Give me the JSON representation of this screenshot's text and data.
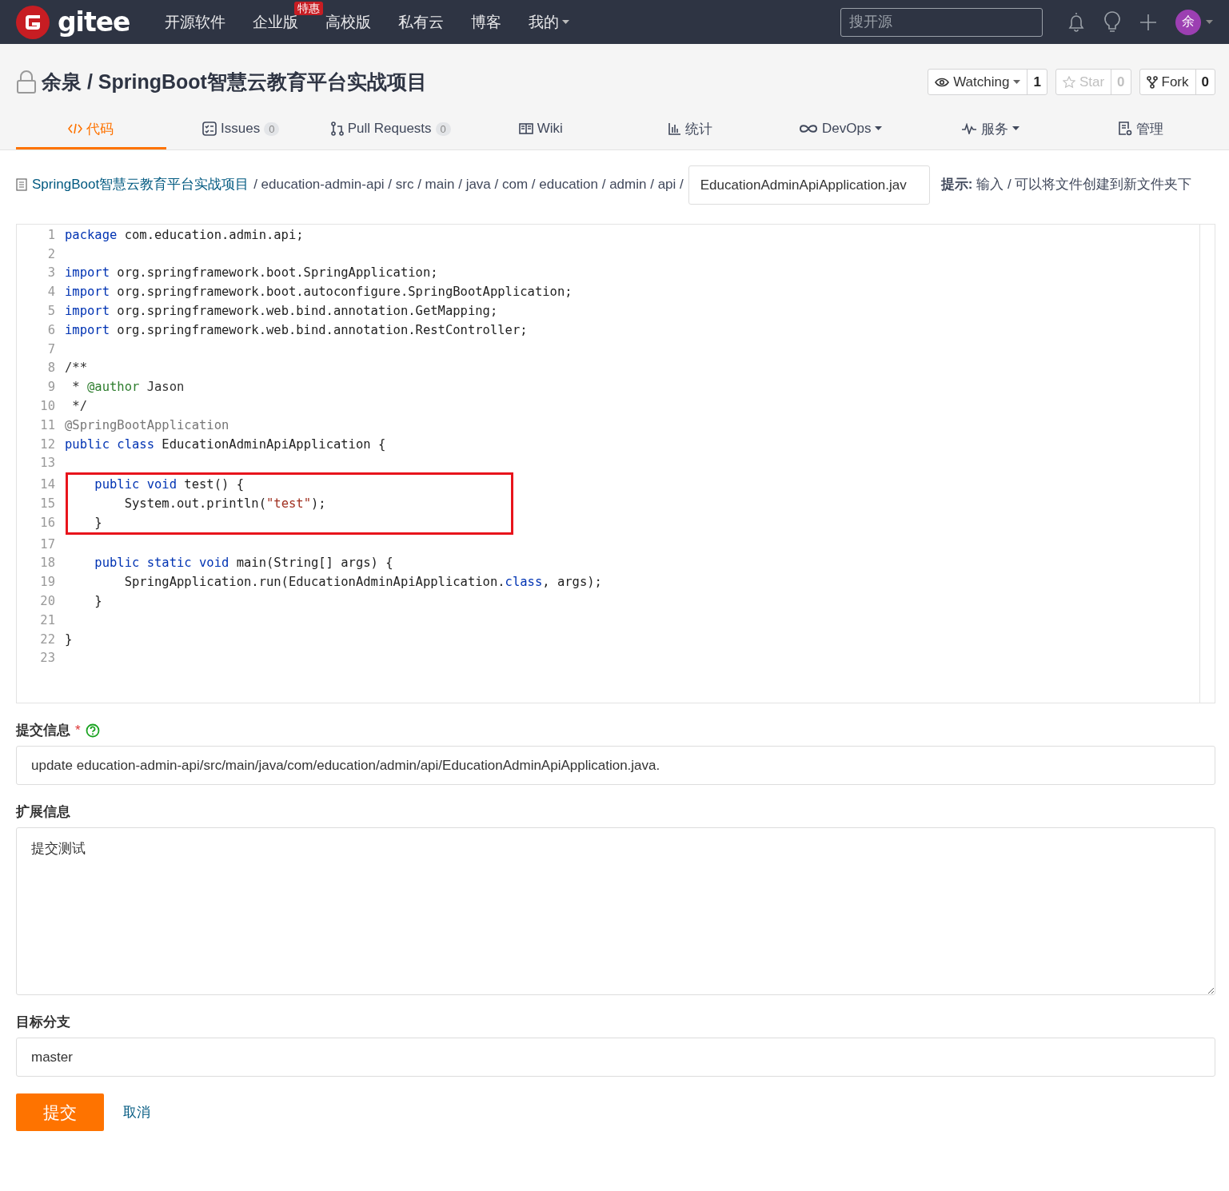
{
  "navbar": {
    "logo": "gitee",
    "links": [
      {
        "label": "开源软件"
      },
      {
        "label": "企业版",
        "badge": "特惠"
      },
      {
        "label": "高校版"
      },
      {
        "label": "私有云"
      },
      {
        "label": "博客"
      },
      {
        "label": "我的",
        "dropdown": true
      }
    ],
    "search": {
      "placeholder": "搜开源"
    },
    "avatar": "余"
  },
  "repo": {
    "title": "余泉 / SpringBoot智慧云教育平台实战项目",
    "actions": [
      {
        "label": "Watching",
        "count": "1",
        "dropdown": true,
        "disabled": false
      },
      {
        "label": "Star",
        "count": "0",
        "disabled": true
      },
      {
        "label": "Fork",
        "count": "0",
        "disabled": false
      }
    ]
  },
  "tabs": [
    {
      "label": "代码",
      "selected": true
    },
    {
      "label": "Issues",
      "count": "0",
      "selected": false
    },
    {
      "label": "Pull Requests",
      "count": "0",
      "selected": false
    },
    {
      "label": "Wiki",
      "selected": false
    },
    {
      "label": "统计",
      "selected": false
    },
    {
      "label": "DevOps",
      "selected": false,
      "dropdown": true
    },
    {
      "label": "服务",
      "selected": false,
      "dropdown": true
    },
    {
      "label": "管理",
      "selected": false
    }
  ],
  "breadcrumb": {
    "root": "SpringBoot智慧云教育平台实战项目",
    "path": "/ education-admin-api / src / main / java / com / education / admin / api /",
    "filename": "EducationAdminApiApplication.jav",
    "hint_label": "提示:",
    "hint": " 输入 / 可以将文件创建到新文件夹下"
  },
  "code": [
    {
      "num": "1",
      "tokens": [
        {
          "kind": "kw",
          "text": "package "
        },
        {
          "kind": "plain",
          "text": "com.education.admin.api;"
        }
      ]
    },
    {
      "num": "2"
    },
    {
      "num": "3",
      "tokens": [
        {
          "kind": "kw",
          "text": "import "
        },
        {
          "kind": "plain",
          "text": "org.springframework.boot.SpringApplication;"
        }
      ]
    },
    {
      "num": "4",
      "tokens": [
        {
          "kind": "kw",
          "text": "import "
        },
        {
          "kind": "plain",
          "text": "org.springframework.boot.autoconfigure.SpringBootApplication;"
        }
      ]
    },
    {
      "num": "5",
      "tokens": [
        {
          "kind": "kw",
          "text": "import "
        },
        {
          "kind": "plain",
          "text": "org.springframework.web.bind.annotation.GetMapping;"
        }
      ]
    },
    {
      "num": "6",
      "tokens": [
        {
          "kind": "kw",
          "text": "import "
        },
        {
          "kind": "plain",
          "text": "org.springframework.web.bind.annotation.RestController;"
        }
      ]
    },
    {
      "num": "7"
    },
    {
      "num": "8",
      "tokens": [
        {
          "kind": "comment",
          "text": "/**"
        }
      ]
    },
    {
      "num": "9",
      "tokens": [
        {
          "kind": "comment",
          "text": " * "
        },
        {
          "kind": "tag",
          "text": "@author"
        },
        {
          "kind": "comment",
          "text": " Jason"
        }
      ]
    },
    {
      "num": "10",
      "tokens": [
        {
          "kind": "comment",
          "text": " */"
        }
      ]
    },
    {
      "num": "11",
      "tokens": [
        {
          "kind": "annotation",
          "text": "@SpringBootApplication"
        }
      ]
    },
    {
      "num": "12",
      "tokens": [
        {
          "kind": "kw",
          "text": "public class "
        },
        {
          "kind": "plain",
          "text": "EducationAdminApiApplication {"
        }
      ]
    },
    {
      "num": "13"
    },
    {
      "num": "14",
      "highlighted": true,
      "tokens": [
        {
          "kind": "kw",
          "text": "    public void "
        },
        {
          "kind": "plain",
          "text": "test() {"
        }
      ]
    },
    {
      "num": "15",
      "highlighted": true,
      "tokens": [
        {
          "kind": "plain",
          "text": "        System.out.println("
        },
        {
          "kind": "string",
          "text": "\"test\""
        },
        {
          "kind": "plain",
          "text": ");"
        }
      ]
    },
    {
      "num": "16",
      "highlighted": true,
      "tokens": [
        {
          "kind": "plain",
          "text": "    }"
        }
      ]
    },
    {
      "num": "17"
    },
    {
      "num": "18",
      "tokens": [
        {
          "kind": "kw",
          "text": "    public static void "
        },
        {
          "kind": "plain",
          "text": "main(String[] args) {"
        }
      ]
    },
    {
      "num": "19",
      "tokens": [
        {
          "kind": "plain",
          "text": "        SpringApplication.run(EducationAdminApiApplication."
        },
        {
          "kind": "kw",
          "text": "class"
        },
        {
          "kind": "plain",
          "text": ", args);"
        }
      ]
    },
    {
      "num": "20",
      "tokens": [
        {
          "kind": "plain",
          "text": "    }"
        }
      ]
    },
    {
      "num": "21"
    },
    {
      "num": "22",
      "tokens": [
        {
          "kind": "plain",
          "text": "}"
        }
      ]
    },
    {
      "num": "23"
    }
  ],
  "form": {
    "commit_label": "提交信息",
    "required_mark": "*",
    "commit_value": "update education-admin-api/src/main/java/com/education/admin/api/EducationAdminApiApplication.java.",
    "ext_label": "扩展信息",
    "ext_value": "提交测试",
    "branch_label": "目标分支",
    "branch_value": "master",
    "submit": "提交",
    "cancel": "取消"
  }
}
